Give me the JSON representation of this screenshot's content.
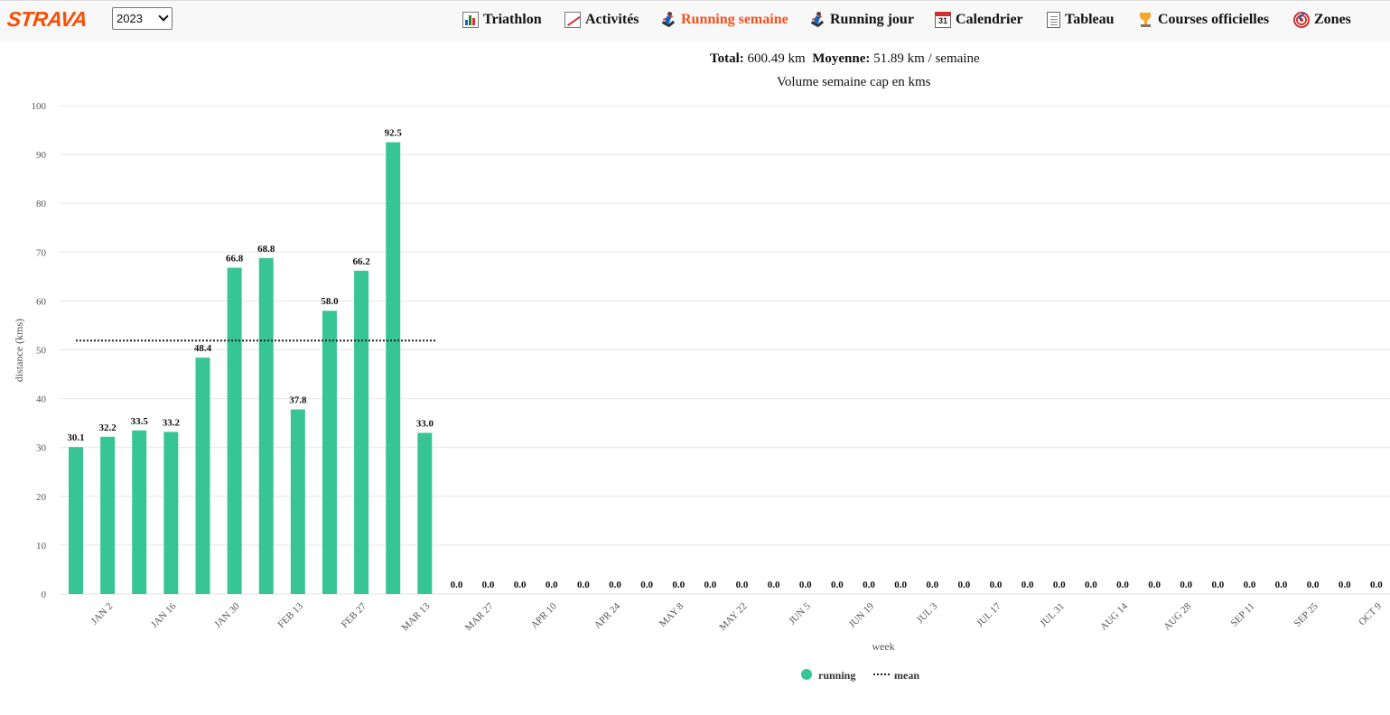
{
  "navbar": {
    "logo": "STRAVA",
    "year_select": {
      "value": "2023"
    },
    "items": [
      {
        "label": "Triathlon",
        "icon": "bar-chart-icon",
        "active": false
      },
      {
        "label": "Activités",
        "icon": "line-chart-icon",
        "active": false
      },
      {
        "label": "Running semaine",
        "icon": "runner-icon",
        "active": true
      },
      {
        "label": "Running jour",
        "icon": "runner-icon",
        "active": false
      },
      {
        "label": "Calendrier",
        "icon": "calendar-icon",
        "active": false
      },
      {
        "label": "Tableau",
        "icon": "document-icon",
        "active": false
      },
      {
        "label": "Courses officielles",
        "icon": "trophy-icon",
        "active": false
      },
      {
        "label": "Zones",
        "icon": "target-icon",
        "active": false
      }
    ],
    "calendar_icon_day": "31"
  },
  "summary": {
    "total_label": "Total:",
    "total_value": "600.49 km",
    "mean_label": "Moyenne:",
    "mean_value": "51.89 km / semaine"
  },
  "chart_data": {
    "type": "bar",
    "title": "Volume semaine cap en kms",
    "xlabel": "week",
    "ylabel": "distance (kms)",
    "ylim": [
      0,
      100
    ],
    "yticks": [
      0,
      10,
      20,
      30,
      40,
      50,
      60,
      70,
      80,
      90,
      100
    ],
    "grid": true,
    "legend_position": "bottom",
    "x_tick_labels": [
      "JAN 2",
      "JAN 16",
      "JAN 30",
      "FEB 13",
      "FEB 27",
      "MAR 13",
      "MAR 27",
      "APR 10",
      "APR 24",
      "MAY 8",
      "MAY 22",
      "JUN 5",
      "JUN 19",
      "JUL 3",
      "JUL 17",
      "JUL 31",
      "AUG 14",
      "AUG 28",
      "SEP 11",
      "SEP 25",
      "OCT 9"
    ],
    "series": [
      {
        "name": "running",
        "color": "#38c596",
        "values": [
          30.1,
          32.2,
          33.5,
          33.2,
          48.4,
          66.8,
          68.8,
          37.8,
          58.0,
          66.2,
          92.5,
          33.0,
          0.0,
          0.0,
          0.0,
          0.0,
          0.0,
          0.0,
          0.0,
          0.0,
          0.0,
          0.0,
          0.0,
          0.0,
          0.0,
          0.0,
          0.0,
          0.0,
          0.0,
          0.0,
          0.0,
          0.0,
          0.0,
          0.0,
          0.0,
          0.0,
          0.0,
          0.0,
          0.0,
          0.0,
          0.0,
          0.0
        ]
      },
      {
        "name": "mean",
        "color": "#222222",
        "style": "dotted",
        "value": 51.89,
        "span_weeks": [
          0,
          11
        ]
      }
    ]
  }
}
